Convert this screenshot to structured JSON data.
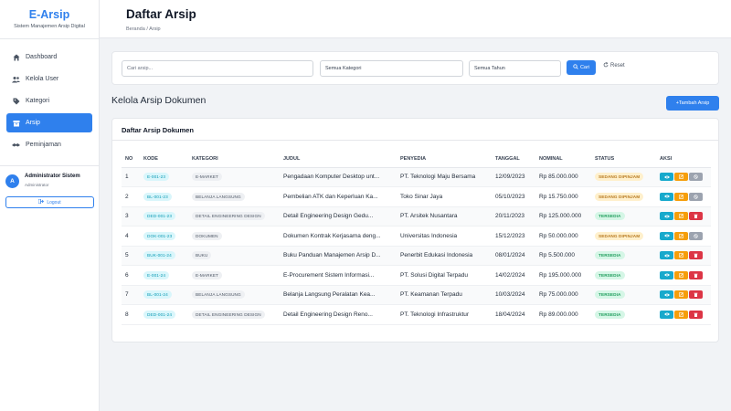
{
  "brand": {
    "title": "E-Arsip",
    "subtitle": "Sistem Manajemen Arsip Digital"
  },
  "nav": [
    {
      "label": "Dashboard",
      "icon": "home-icon",
      "active": false
    },
    {
      "label": "Kelola User",
      "icon": "users-icon",
      "active": false
    },
    {
      "label": "Kategori",
      "icon": "tag-icon",
      "active": false
    },
    {
      "label": "Arsip",
      "icon": "archive-icon",
      "active": true
    },
    {
      "label": "Peminjaman",
      "icon": "handshake-icon",
      "active": false
    }
  ],
  "user": {
    "initial": "A",
    "name": "Administrator Sistem",
    "role": "Administrator",
    "logout_label": "Logout"
  },
  "header": {
    "title": "Daftar Arsip",
    "breadcrumb": "Beranda / Arsip"
  },
  "filters": {
    "search_placeholder": "Cari arsip...",
    "category_value": "Semua Kategori",
    "year_value": "Semua Tahun",
    "search_button": "Cari",
    "reset_button": "Reset"
  },
  "section": {
    "title": "Kelola Arsip Dokumen",
    "add_button": "+Tambah Arsip"
  },
  "table": {
    "card_title": "Daftar Arsip Dokumen",
    "columns": [
      "NO",
      "KODE",
      "KATEGORI",
      "JUDUL",
      "PENYEDIA",
      "TANGGAL",
      "NOMINAL",
      "STATUS",
      "AKSI"
    ],
    "rows": [
      {
        "no": "1",
        "kode": "E-001-23",
        "kategori": "E-MARKET",
        "judul": "Pengadaan Komputer Desktop unt...",
        "penyedia": "PT. Teknologi Maju Bersama",
        "tanggal": "12/09/2023",
        "nominal": "Rp 85.000.000",
        "status": "SEDANG DIPINJAM",
        "borrowed": true
      },
      {
        "no": "2",
        "kode": "BL-001-23",
        "kategori": "BELANJA LANGSUNG",
        "judul": "Pembelian ATK dan Keperluan Ka...",
        "penyedia": "Toko Sinar Jaya",
        "tanggal": "05/10/2023",
        "nominal": "Rp 15.750.000",
        "status": "SEDANG DIPINJAM",
        "borrowed": true
      },
      {
        "no": "3",
        "kode": "DED-001-23",
        "kategori": "DETAIL ENGINEERING DESIGN",
        "judul": "Detail Engineering Design Gedu...",
        "penyedia": "PT. Arsitek Nusantara",
        "tanggal": "20/11/2023",
        "nominal": "Rp 125.000.000",
        "status": "TERSEDIA",
        "borrowed": false
      },
      {
        "no": "4",
        "kode": "DOK-001-23",
        "kategori": "DOKUMEN",
        "judul": "Dokumen Kontrak Kerjasama deng...",
        "penyedia": "Universitas Indonesia",
        "tanggal": "15/12/2023",
        "nominal": "Rp 50.000.000",
        "status": "SEDANG DIPINJAM",
        "borrowed": true
      },
      {
        "no": "5",
        "kode": "BUK-001-24",
        "kategori": "BUKU",
        "judul": "Buku Panduan Manajemen Arsip D...",
        "penyedia": "Penerbit Edukasi Indonesia",
        "tanggal": "08/01/2024",
        "nominal": "Rp 5.500.000",
        "status": "TERSEDIA",
        "borrowed": false
      },
      {
        "no": "6",
        "kode": "E-001-24",
        "kategori": "E-MARKET",
        "judul": "E-Procurement Sistem Informasi...",
        "penyedia": "PT. Solusi Digital Terpadu",
        "tanggal": "14/02/2024",
        "nominal": "Rp 195.000.000",
        "status": "TERSEDIA",
        "borrowed": false
      },
      {
        "no": "7",
        "kode": "BL-001-24",
        "kategori": "BELANJA LANGSUNG",
        "judul": "Belanja Langsung Peralatan Kea...",
        "penyedia": "PT. Keamanan Terpadu",
        "tanggal": "10/03/2024",
        "nominal": "Rp 75.000.000",
        "status": "TERSEDIA",
        "borrowed": false
      },
      {
        "no": "8",
        "kode": "DED-001-24",
        "kategori": "DETAIL ENGINEERING DESIGN",
        "judul": "Detail Engineering Design Reno...",
        "penyedia": "PT. Teknologi Infrastruktur",
        "tanggal": "18/04/2024",
        "nominal": "Rp 89.000.000",
        "status": "TERSEDIA",
        "borrowed": false
      }
    ]
  },
  "colors": {
    "accent": "#2f80ed",
    "borrowed": "#b7791f",
    "available": "#1f9d5c",
    "view": "#17a9cc",
    "edit": "#f59e0b",
    "delete": "#dc3545",
    "disabled": "#9ca3af"
  }
}
